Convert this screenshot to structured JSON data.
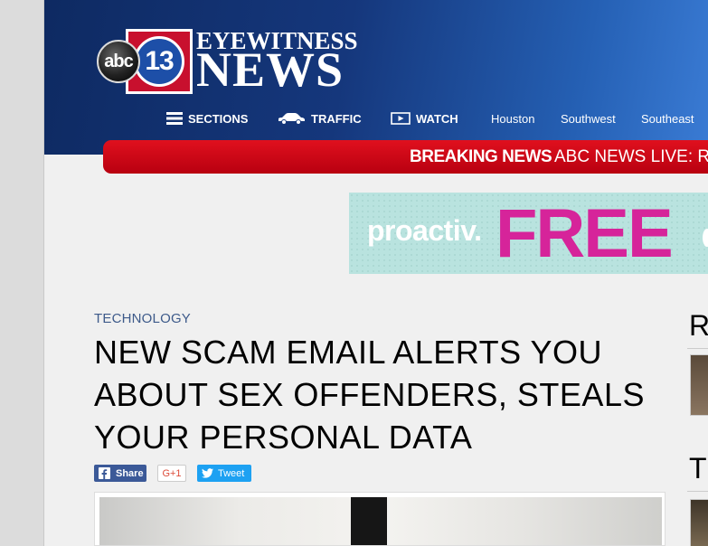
{
  "header": {
    "logo": {
      "abc": "abc",
      "number": "13",
      "line1": "EYEWITNESS",
      "line2": "NEWS"
    },
    "nav": [
      {
        "label": "SECTIONS",
        "icon": "hamburger-menu-icon"
      },
      {
        "label": "TRAFFIC",
        "icon": "car-icon"
      },
      {
        "label": "WATCH",
        "icon": "play-video-icon"
      },
      {
        "label": "Houston"
      },
      {
        "label": "Southwest"
      },
      {
        "label": "Southeast"
      }
    ]
  },
  "breaking_news": {
    "label": "BREAKING NEWS",
    "text": "ABC NEWS LIVE: Rep"
  },
  "ad": {
    "brand": "proactiv.",
    "offer": "FREE"
  },
  "article": {
    "category": "TECHNOLOGY",
    "headline": "NEW SCAM EMAIL ALERTS YOU ABOUT SEX OFFENDERS, STEALS YOUR PERSONAL DATA",
    "share": {
      "facebook": "Share",
      "google": "G+1",
      "twitter": "Tweet"
    }
  },
  "sidebar": {
    "heading1_partial": "R",
    "heading2_partial": "T"
  },
  "colors": {
    "header_dark": "#0e2a62",
    "header_light": "#3a7bd4",
    "breaking_red": "#d0001a",
    "ad_pink": "#d6249a",
    "ad_bg": "#b9e3df"
  }
}
